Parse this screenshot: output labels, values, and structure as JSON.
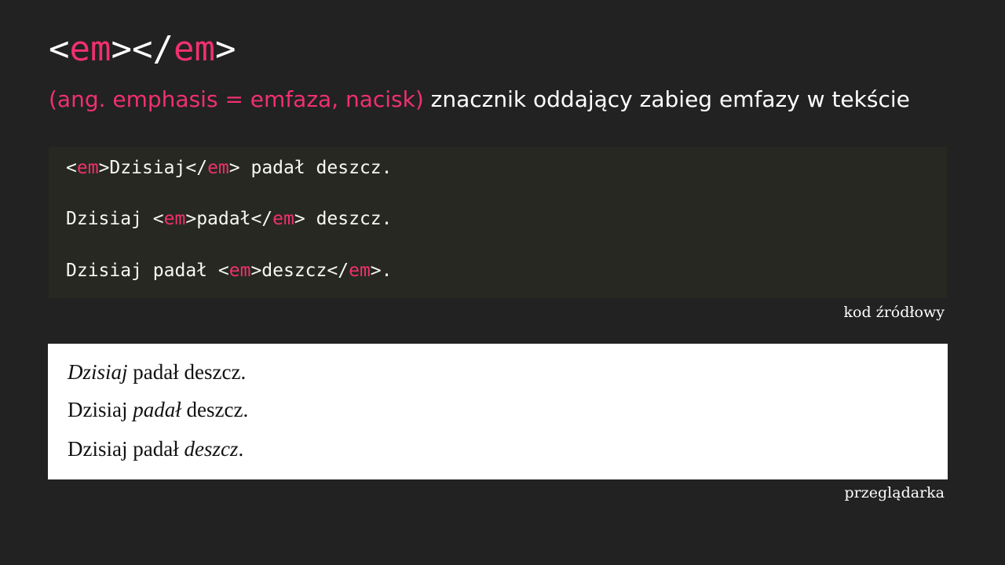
{
  "slide": {
    "title": {
      "open_lt": "<",
      "open_tag": "em",
      "open_gt": ">",
      "close_lt": "</",
      "close_tag": "em",
      "close_gt": ">"
    },
    "subtitle": {
      "highlight": "(ang. emphasis = emfaza, nacisk)",
      "rest": " znacznik oddający zabieg emfazy w tekście"
    },
    "code_lines": [
      {
        "before": "",
        "lt": "<",
        "tag1": "em",
        "gt": ">",
        "inner": "Dzisiaj",
        "clt": "</",
        "tag2": "em",
        "cgt": ">",
        "after": " padał deszcz."
      },
      {
        "before": "Dzisiaj ",
        "lt": "<",
        "tag1": "em",
        "gt": ">",
        "inner": "padał",
        "clt": "</",
        "tag2": "em",
        "cgt": ">",
        "after": " deszcz."
      },
      {
        "before": "Dzisiaj padał ",
        "lt": "<",
        "tag1": "em",
        "gt": ">",
        "inner": "deszcz",
        "clt": "</",
        "tag2": "em",
        "cgt": ">",
        "after": "."
      }
    ],
    "code_caption": "kod źródłowy",
    "browser_lines": [
      {
        "before": "",
        "em": "Dzisiaj",
        "after": " padał deszcz."
      },
      {
        "before": "Dzisiaj ",
        "em": "padał",
        "after": " deszcz."
      },
      {
        "before": "Dzisiaj padał ",
        "em": "deszcz",
        "after": "."
      }
    ],
    "browser_caption": "przeglądarka",
    "colors": {
      "background": "#222222",
      "accent": "#f0306f",
      "code_background": "#272822",
      "browser_background": "#ffffff"
    }
  }
}
